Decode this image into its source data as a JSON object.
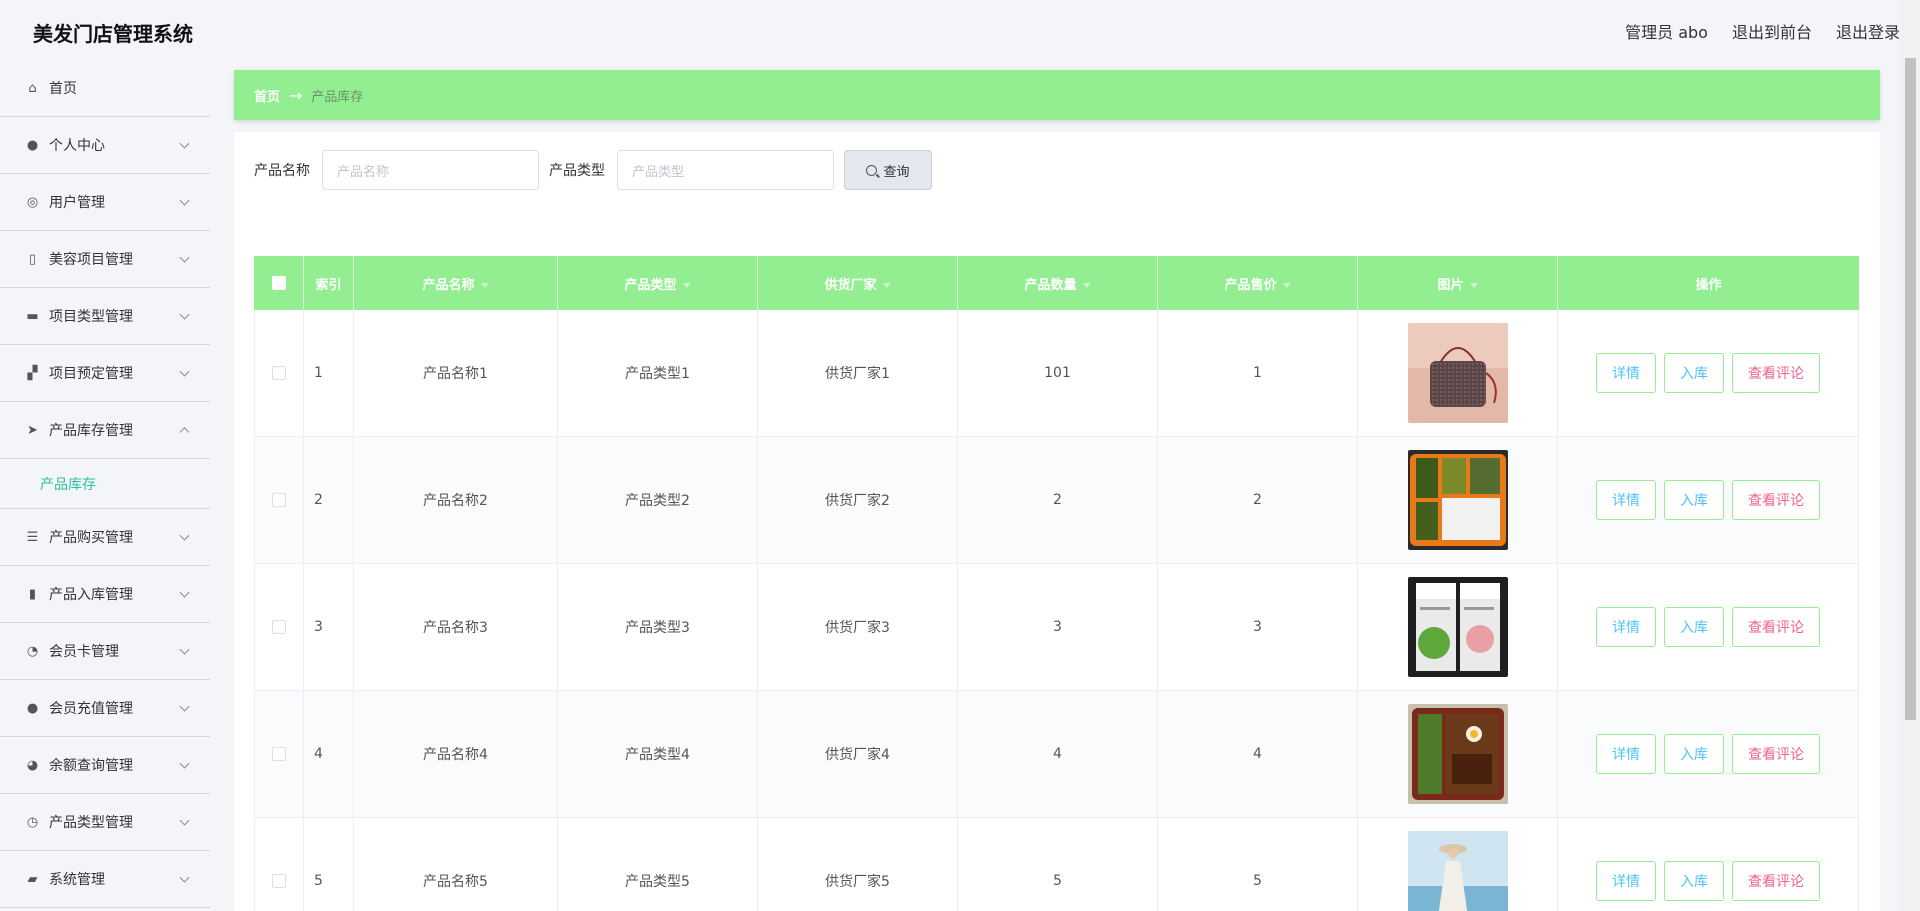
{
  "app": {
    "title": "美发门店管理系统"
  },
  "header": {
    "user": "管理员 abo",
    "to_front": "退出到前台",
    "logout": "退出登录"
  },
  "sidebar": {
    "items": [
      {
        "label": "首页",
        "icon": "home-icon",
        "glyph": "⌂",
        "expandable": false
      },
      {
        "label": "个人中心",
        "icon": "user-icon",
        "glyph": "●",
        "expandable": true
      },
      {
        "label": "用户管理",
        "icon": "users-icon",
        "glyph": "◎",
        "expandable": true
      },
      {
        "label": "美容项目管理",
        "icon": "mic-icon",
        "glyph": "▯",
        "expandable": true
      },
      {
        "label": "项目类型管理",
        "icon": "chat-icon",
        "glyph": "▬",
        "expandable": true
      },
      {
        "label": "项目预定管理",
        "icon": "thumb-icon",
        "glyph": "▞",
        "expandable": true
      },
      {
        "label": "产品库存管理",
        "icon": "send-icon",
        "glyph": "➤",
        "expandable": true,
        "expanded": true,
        "sub": [
          {
            "label": "产品库存"
          }
        ]
      },
      {
        "label": "产品购买管理",
        "icon": "list-icon",
        "glyph": "☰",
        "expandable": true
      },
      {
        "label": "产品入库管理",
        "icon": "bar-icon",
        "glyph": "▮",
        "expandable": true
      },
      {
        "label": "会员卡管理",
        "icon": "compass-icon",
        "glyph": "◔",
        "expandable": true
      },
      {
        "label": "会员充值管理",
        "icon": "person-icon",
        "glyph": "●",
        "expandable": true
      },
      {
        "label": "余额查询管理",
        "icon": "gauge-icon",
        "glyph": "◕",
        "expandable": true
      },
      {
        "label": "产品类型管理",
        "icon": "clock-icon",
        "glyph": "◷",
        "expandable": true
      },
      {
        "label": "系统管理",
        "icon": "video-icon",
        "glyph": "▰",
        "expandable": true
      }
    ]
  },
  "breadcrumb": {
    "home": "首页",
    "arrow": "→",
    "current": "产品库存"
  },
  "search": {
    "name_label": "产品名称",
    "name_placeholder": "产品名称",
    "type_label": "产品类型",
    "type_placeholder": "产品类型",
    "button": "查询"
  },
  "table": {
    "headers": [
      "",
      "索引",
      "产品名称",
      "产品类型",
      "供货厂家",
      "产品数量",
      "产品售价",
      "图片",
      "操作"
    ],
    "rows": [
      {
        "index": "1",
        "name": "产品名称1",
        "type": "产品类型1",
        "vendor": "供货厂家1",
        "qty": "101",
        "price": "1",
        "image": "handbag"
      },
      {
        "index": "2",
        "name": "产品名称2",
        "type": "产品类型2",
        "vendor": "供货厂家2",
        "qty": "2",
        "price": "2",
        "image": "bento-rice"
      },
      {
        "index": "3",
        "name": "产品名称3",
        "type": "产品类型3",
        "vendor": "供货厂家3",
        "qty": "3",
        "price": "3",
        "image": "face-masks"
      },
      {
        "index": "4",
        "name": "产品名称4",
        "type": "产品类型4",
        "vendor": "供货厂家4",
        "qty": "4",
        "price": "4",
        "image": "bento-meat"
      },
      {
        "index": "5",
        "name": "产品名称5",
        "type": "产品类型5",
        "vendor": "供货厂家5",
        "qty": "5",
        "price": "5",
        "image": "beach-dress"
      }
    ],
    "actions": {
      "detail": "详情",
      "stock_in": "入库",
      "reviews": "查看评论"
    }
  },
  "colors": {
    "accent": "#92ee90",
    "sub_active": "#2fc1a0",
    "action_blue": "#4fc3f7",
    "action_pink": "#f06292"
  }
}
